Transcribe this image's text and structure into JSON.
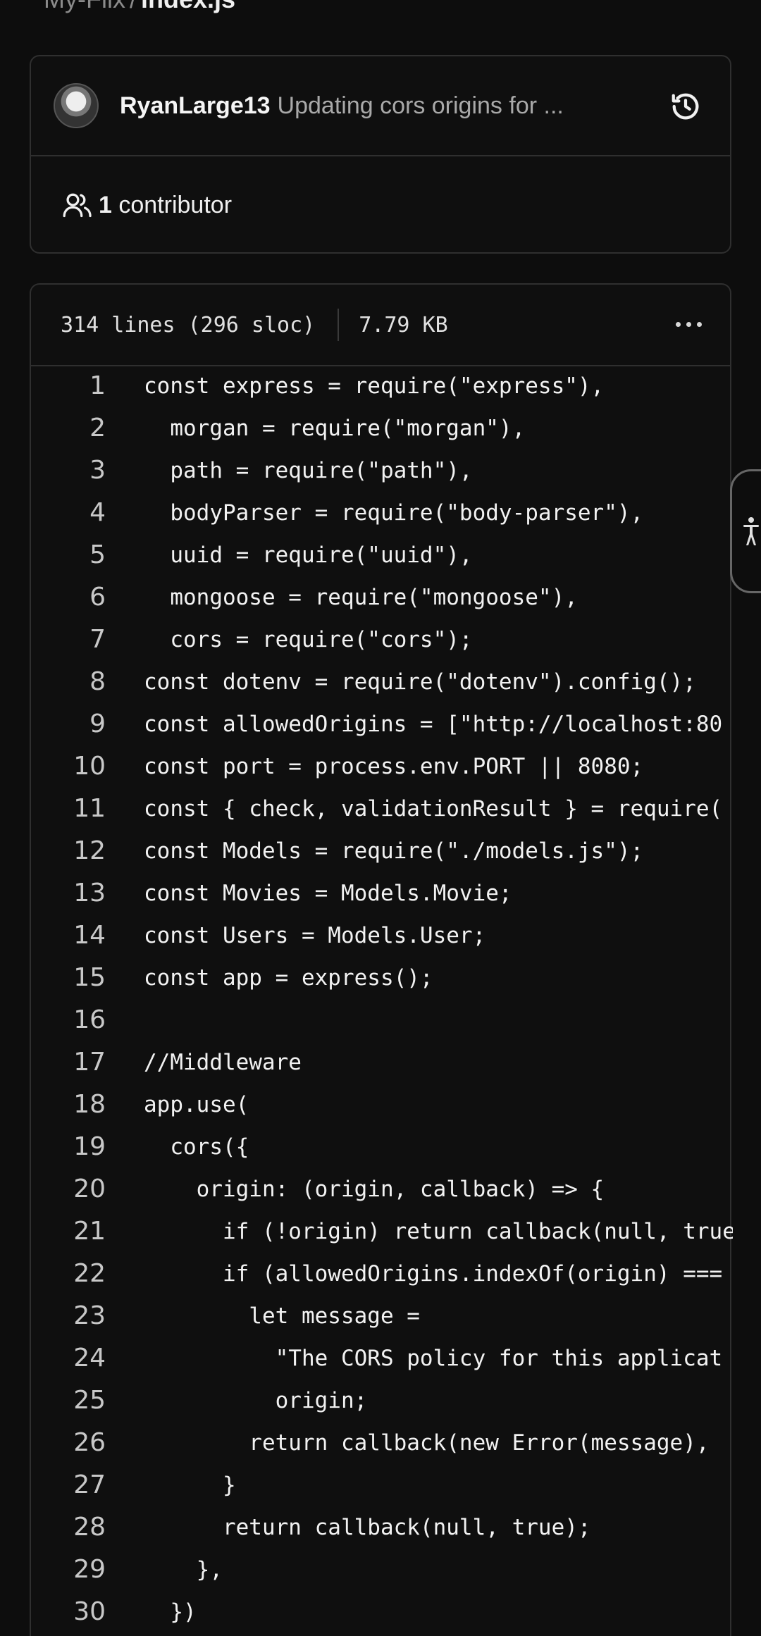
{
  "breadcrumb": {
    "repo": "My-Flix",
    "separator": "/",
    "file": "index.js"
  },
  "commit": {
    "author": "RyanLarge13",
    "message": "Updating cors origins for ...",
    "contributors_count": "1",
    "contributors_label": "contributor"
  },
  "file": {
    "lines_info": "314 lines (296 sloc)",
    "size": "7.79 KB"
  },
  "code_lines": [
    {
      "n": "1",
      "text": "const express = require(\"express\"),"
    },
    {
      "n": "2",
      "text": "  morgan = require(\"morgan\"),"
    },
    {
      "n": "3",
      "text": "  path = require(\"path\"),"
    },
    {
      "n": "4",
      "text": "  bodyParser = require(\"body-parser\"),"
    },
    {
      "n": "5",
      "text": "  uuid = require(\"uuid\"),"
    },
    {
      "n": "6",
      "text": "  mongoose = require(\"mongoose\"),"
    },
    {
      "n": "7",
      "text": "  cors = require(\"cors\");"
    },
    {
      "n": "8",
      "text": "const dotenv = require(\"dotenv\").config();"
    },
    {
      "n": "9",
      "text": "const allowedOrigins = [\"http://localhost:80"
    },
    {
      "n": "10",
      "text": "const port = process.env.PORT || 8080;"
    },
    {
      "n": "11",
      "text": "const { check, validationResult } = require("
    },
    {
      "n": "12",
      "text": "const Models = require(\"./models.js\");"
    },
    {
      "n": "13",
      "text": "const Movies = Models.Movie;"
    },
    {
      "n": "14",
      "text": "const Users = Models.User;"
    },
    {
      "n": "15",
      "text": "const app = express();"
    },
    {
      "n": "16",
      "text": ""
    },
    {
      "n": "17",
      "text": "//Middleware"
    },
    {
      "n": "18",
      "text": "app.use("
    },
    {
      "n": "19",
      "text": "  cors({"
    },
    {
      "n": "20",
      "text": "    origin: (origin, callback) => {"
    },
    {
      "n": "21",
      "text": "      if (!origin) return callback(null, true"
    },
    {
      "n": "22",
      "text": "      if (allowedOrigins.indexOf(origin) ==="
    },
    {
      "n": "23",
      "text": "        let message ="
    },
    {
      "n": "24",
      "text": "          \"The CORS policy for this applicat"
    },
    {
      "n": "25",
      "text": "          origin;"
    },
    {
      "n": "26",
      "text": "        return callback(new Error(message), "
    },
    {
      "n": "27",
      "text": "      }"
    },
    {
      "n": "28",
      "text": "      return callback(null, true);"
    },
    {
      "n": "29",
      "text": "    },"
    },
    {
      "n": "30",
      "text": "  })"
    }
  ],
  "icons": {
    "history": "history-icon",
    "people": "people-icon",
    "more": "more-icon",
    "accessibility": "accessibility-icon"
  }
}
